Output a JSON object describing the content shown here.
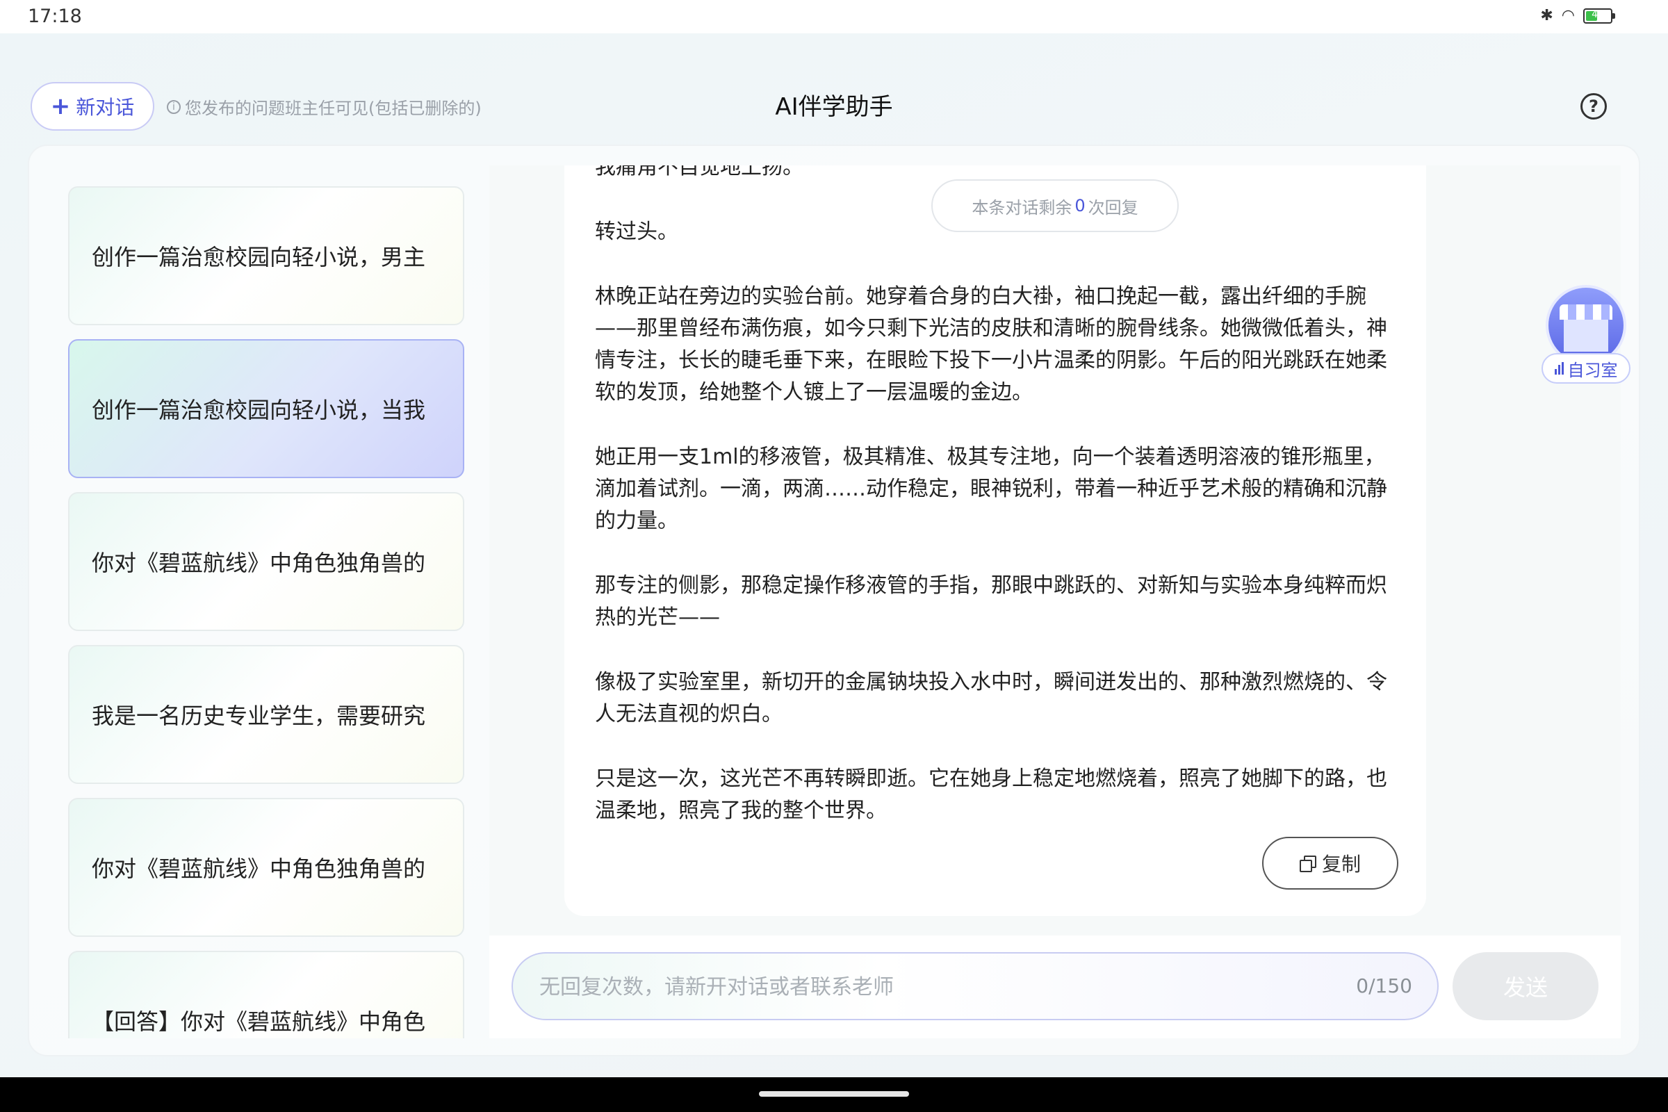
{
  "status_bar": {
    "time": "17:18",
    "battery_level": "46",
    "battery_fraction": 0.46
  },
  "header": {
    "new_chat_label": "新对话",
    "notice": "您发布的问题班主任可见(包括已删除的)",
    "title": "AI伴学助手"
  },
  "sidebar": {
    "items": [
      {
        "label": "创作一篇治愈校园向轻小说，男主",
        "active": false
      },
      {
        "label": "创作一篇治愈校园向轻小说，当我",
        "active": true
      },
      {
        "label": "你对《碧蓝航线》中角色独角兽的",
        "active": false
      },
      {
        "label": "我是一名历史专业学生，需要研究",
        "active": false
      },
      {
        "label": "你对《碧蓝航线》中角色独角兽的",
        "active": false
      },
      {
        "label": "【回答】你对《碧蓝航线》中角色",
        "active": false
      }
    ]
  },
  "chat": {
    "remaining": {
      "prefix": "本条对话剩余",
      "count": "0",
      "suffix": "次回复"
    },
    "paragraphs": [
      "我痛角不自觉地上扬。",
      "转过头。",
      "林晚正站在旁边的实验台前。她穿着合身的白大褂，袖口挽起一截，露出纤细的手腕——那里曾经布满伤痕，如今只剩下光洁的皮肤和清晰的腕骨线条。她微微低着头，神情专注，长长的睫毛垂下来，在眼睑下投下一小片温柔的阴影。午后的阳光跳跃在她柔软的发顶，给她整个人镀上了一层温暖的金边。",
      "她正用一支1ml的移液管，极其精准、极其专注地，向一个装着透明溶液的锥形瓶里，滴加着试剂。一滴，两滴……动作稳定，眼神锐利，带着一种近乎艺术般的精确和沉静的力量。",
      "那专注的侧影，那稳定操作移液管的手指，那眼中跳跃的、对新知与实验本身纯粹而炽热的光芒——",
      "像极了实验室里，新切开的金属钠块投入水中时，瞬间迸发出的、那种激烈燃烧的、令人无法直视的炽白。",
      "只是这一次，这光芒不再转瞬即逝。它在她身上稳定地燃烧着，照亮了她脚下的路，也温柔地，照亮了我的整个世界。"
    ],
    "copy_label": "复制"
  },
  "input": {
    "placeholder": "无回复次数，请新开对话或者联系老师",
    "counter": "0/150",
    "send_label": "发送"
  },
  "study_room": {
    "label": "自习室",
    "badge": "自习"
  }
}
